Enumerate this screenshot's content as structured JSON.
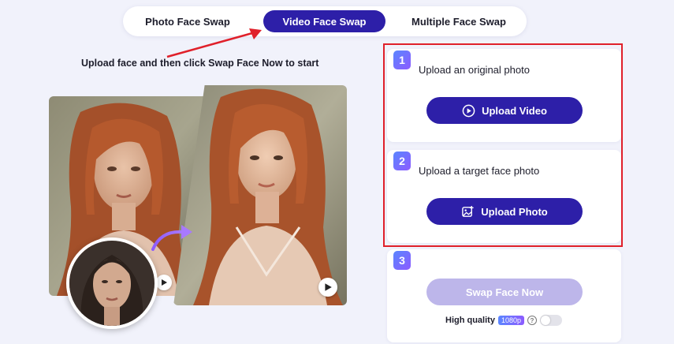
{
  "tabs": [
    {
      "label": "Photo Face Swap",
      "active": false
    },
    {
      "label": "Video Face Swap",
      "active": true
    },
    {
      "label": "Multiple Face Swap",
      "active": false
    }
  ],
  "instruction": "Upload face and then click Swap Face Now to start",
  "steps": [
    {
      "number": "1",
      "title": "Upload an original photo",
      "button_label": "Upload Video",
      "button_icon": "play-circle-icon"
    },
    {
      "number": "2",
      "title": "Upload a target face photo",
      "button_label": "Upload Photo",
      "button_icon": "image-upload-icon"
    },
    {
      "number": "3",
      "button_label": "Swap Face Now",
      "quality_label": "High quality",
      "quality_badge": "1080p",
      "help": "?"
    }
  ],
  "colors": {
    "accent": "#2d1fa8",
    "accent_disabled": "#bdb6ea",
    "annotation": "#e0202a",
    "background": "#f1f2fb"
  }
}
